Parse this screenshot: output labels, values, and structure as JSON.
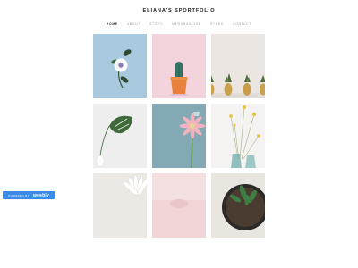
{
  "site": {
    "title": "ELIANA'S SPORTFOLIO"
  },
  "nav": {
    "items": [
      {
        "label": "HOME",
        "active": true
      },
      {
        "label": "ABOUT"
      },
      {
        "label": "STORY"
      },
      {
        "label": "MERCHANDISE"
      },
      {
        "label": "STORE"
      },
      {
        "label": "CONTACT"
      }
    ]
  },
  "gallery": {
    "tiles": [
      {
        "icon": "rose-icon",
        "background": "#a9c9de"
      },
      {
        "icon": "cactus-icon",
        "background": "#f4d4dc"
      },
      {
        "icon": "pineapple-icon",
        "background": "#ebe6e2"
      },
      {
        "icon": "monstera-leaf-icon",
        "background": "#eeeeee"
      },
      {
        "icon": "gerbera-icon",
        "background": "#82a9b4"
      },
      {
        "icon": "yellow-flowers-icon",
        "background": "#f4f3f1"
      },
      {
        "icon": "daisy-icon",
        "background": "#ece8e4"
      },
      {
        "icon": "pink-flower-icon",
        "background": "#f0d4d6"
      },
      {
        "icon": "potted-plant-icon",
        "background": "#e9e6e0"
      }
    ]
  },
  "badge": {
    "prefix": "POWERED BY",
    "brand": "weebly",
    "color": "#3b8be6"
  }
}
